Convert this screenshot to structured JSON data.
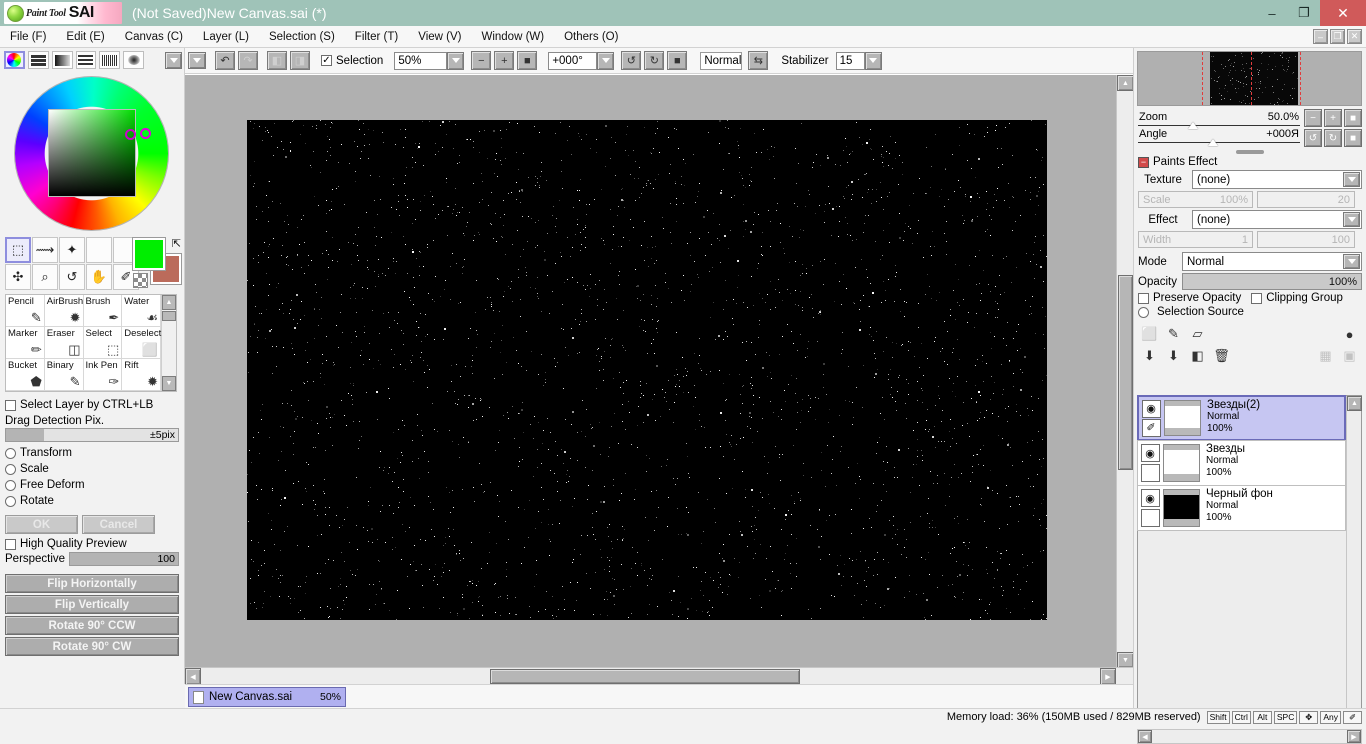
{
  "window": {
    "brand_pt": "Paint Tool",
    "brand_sai": "SAI",
    "title": "(Not Saved)New Canvas.sai (*)",
    "minimize": "–",
    "restore": "❐",
    "close": "✕"
  },
  "menu": {
    "items": [
      "File (F)",
      "Edit (E)",
      "Canvas (C)",
      "Layer (L)",
      "Selection (S)",
      "Filter (T)",
      "View (V)",
      "Window (W)",
      "Others (O)"
    ],
    "mdi_minimize": "–",
    "mdi_restore": "❐",
    "mdi_close": "✕"
  },
  "colorpanel": {
    "tabs": [
      {
        "name": "color-wheel-tab",
        "selected": true
      },
      {
        "name": "rgb-sliders-tab",
        "selected": false
      },
      {
        "name": "gradient-tab",
        "selected": false
      },
      {
        "name": "swatch-list-tab",
        "selected": false
      },
      {
        "name": "palette-grid-tab",
        "selected": false
      },
      {
        "name": "scratchpad-tab",
        "selected": false
      }
    ],
    "foreground_color": "#00ee00",
    "background_color": "#bb6b5b"
  },
  "selection_tools": [
    {
      "name": "rect-select",
      "glyph": "⬚",
      "selected": true
    },
    {
      "name": "lasso-select",
      "glyph": "⟿",
      "selected": false
    },
    {
      "name": "magic-wand",
      "glyph": "✦",
      "selected": false
    },
    {
      "name": "blank-tool-1",
      "glyph": "",
      "selected": false
    },
    {
      "name": "blank-tool-2",
      "glyph": "",
      "selected": false
    },
    {
      "name": "move-tool",
      "glyph": "✣",
      "selected": false
    },
    {
      "name": "zoom-tool",
      "glyph": "⌕",
      "selected": false
    },
    {
      "name": "rotate-tool",
      "glyph": "↺",
      "selected": false
    },
    {
      "name": "hand-tool",
      "glyph": "✋",
      "selected": false
    },
    {
      "name": "eyedropper-tool",
      "glyph": "✐",
      "selected": false
    }
  ],
  "tools": [
    {
      "label": "Pencil",
      "glyph": "✎"
    },
    {
      "label": "AirBrush",
      "glyph": "✹"
    },
    {
      "label": "Brush",
      "glyph": "✒"
    },
    {
      "label": "Water",
      "glyph": "☙"
    },
    {
      "label": "Marker",
      "glyph": "✏"
    },
    {
      "label": "Eraser",
      "glyph": "◫"
    },
    {
      "label": "Select",
      "glyph": "⬚"
    },
    {
      "label": "Deselect",
      "glyph": "⬜"
    },
    {
      "label": "Bucket",
      "glyph": "⬟"
    },
    {
      "label": "Binary",
      "glyph": "✎"
    },
    {
      "label": "Ink Pen",
      "glyph": "✑"
    },
    {
      "label": "Rift",
      "glyph": "✹"
    }
  ],
  "toolopts": {
    "select_layer_label": "Select Layer by CTRL+LB",
    "drag_detection_label": "Drag Detection Pix.",
    "drag_detection_value": "±5pix",
    "modes": [
      "Transform",
      "Scale",
      "Free Deform",
      "Rotate"
    ],
    "ok_label": "OK",
    "cancel_label": "Cancel",
    "hq_preview_label": "High Quality Preview",
    "perspective_label": "Perspective",
    "perspective_value": "100",
    "flip_h": "Flip Horizontally",
    "flip_v": "Flip Vertically",
    "rot_ccw": "Rotate 90° CCW",
    "rot_cw": "Rotate 90° CW"
  },
  "doctoolbar": {
    "undo": "↶",
    "redo": "↷",
    "sel_undo": "◧",
    "sel_redo": "◨",
    "selection_checkbox_label": "Selection",
    "selection_checked": true,
    "zoom_value": "50%",
    "zoom_out": "−",
    "zoom_in": "+",
    "zoom_reset": "■",
    "angle_value": "+000°",
    "rot_ccw": "↺",
    "rot_cw": "↻",
    "rot_reset": "■",
    "mode_value": "Normal",
    "flip_toggle": "⇆",
    "stabilizer_label": "Stabilizer",
    "stabilizer_value": "15"
  },
  "canvas": {
    "zoom_percent": "50%",
    "doc_name": "New Canvas.sai"
  },
  "navigator": {
    "zoom_label": "Zoom",
    "zoom_value": "50.0%",
    "angle_label": "Angle",
    "angle_value": "+000Я",
    "zoom_out": "−",
    "zoom_in": "+",
    "zoom_reset": "■",
    "rot_ccw": "↺",
    "rot_cw": "↻",
    "rot_reset": "■"
  },
  "paints_effect": {
    "section_title": "Paints Effect",
    "collapse_glyph": "−",
    "texture_label": "Texture",
    "texture_value": "(none)",
    "scale_label": "Scale",
    "scale_value": "100%",
    "scale_num": "20",
    "effect_label": "Effect",
    "effect_value": "(none)",
    "width_label": "Width",
    "width_value": "1",
    "width_num": "100",
    "mode_label": "Mode",
    "mode_value": "Normal",
    "opacity_label": "Opacity",
    "opacity_value": "100%",
    "preserve_opacity_label": "Preserve Opacity",
    "clipping_group_label": "Clipping Group",
    "selection_source_label": "Selection Source"
  },
  "layer_toolbar": {
    "new_layer": "⬜",
    "new_linework": "✎",
    "new_folder": "▱",
    "mask": "●",
    "merge_down": "⬇",
    "merge_visible": "⬇",
    "clear": "◧",
    "delete": "Ὕ1",
    "dim1": "▦",
    "dim2": "▣"
  },
  "layers": [
    {
      "name": "Звезды(2)",
      "mode": "Normal",
      "opacity": "100%",
      "selected": true,
      "thumb_color": "#ffffff",
      "eye": "◉",
      "pen": "✐"
    },
    {
      "name": "Звезды",
      "mode": "Normal",
      "opacity": "100%",
      "selected": false,
      "thumb_color": "#ffffff",
      "eye": "◉",
      "pen": ""
    },
    {
      "name": "Черный фон",
      "mode": "Normal",
      "opacity": "100%",
      "selected": false,
      "thumb_color": "#000000",
      "eye": "◉",
      "pen": ""
    }
  ],
  "status": {
    "memory": "Memory load: 36% (150MB used / 829MB reserved)",
    "keys": [
      "Shift",
      "Ctrl",
      "Alt",
      "SPC",
      "✥",
      "Any"
    ],
    "pen_glyph": "✐"
  }
}
